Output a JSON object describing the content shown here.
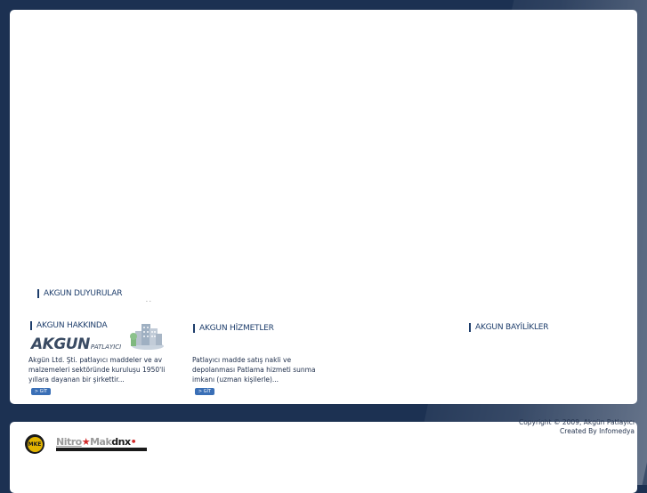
{
  "announcements": {
    "title": "AKGUN DUYURULAR",
    "marquee": ".      ."
  },
  "about": {
    "title": "AKGUN HAKKINDA",
    "logo_main": "AKGUN",
    "logo_sub": "PATLAYICI",
    "text": "Akgün Ltd. Şti. patlayıcı maddeler ve av malzemeleri sektöründe kuruluşu 1950'li yıllara dayanan bir şirkettir...",
    "button": "> GİT"
  },
  "services": {
    "title": "AKGUN HİZMETLER",
    "text": "Patlayıcı madde satış nakli ve depolanması Patlama hizmeti sunma imkanı (uzman kişilerle)...",
    "button": "> GİT"
  },
  "dealers": {
    "title": "AKGUN BAYİLİKLER"
  },
  "footer": {
    "copyright_line1": "Copyright © 2009, Akgün Patlayıcı",
    "copyright_line2": "Created By Infomedya",
    "partner_logo_text": "MKE",
    "partner2_text": "Nitro",
    "partner2_text_b": "Mak",
    "partner2_text_c": "dnx"
  },
  "colors": {
    "background": "#1c3152",
    "panel": "#ffffff",
    "accent": "#3a6fb6",
    "title_text": "#1d3d6b"
  }
}
